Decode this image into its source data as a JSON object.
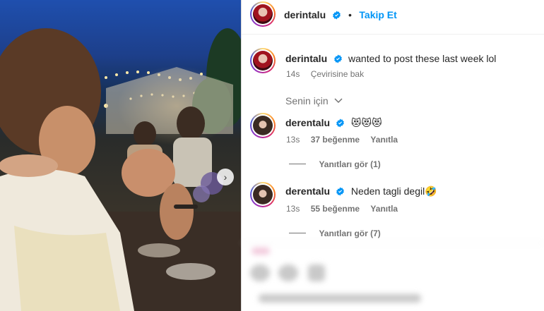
{
  "post": {
    "username": "derintalu",
    "follow_label": "Takip Et",
    "dot": "•"
  },
  "caption": {
    "username": "derintalu",
    "text": "wanted to post these last week lol",
    "time": "14s",
    "translate": "Çevirisine bak"
  },
  "sort": {
    "label": "Senin için"
  },
  "comments": [
    {
      "username": "derentalu",
      "text": "😻😻😻",
      "time": "13s",
      "likes": "37 beğenme",
      "reply": "Yanıtla",
      "view_replies": "Yanıtları gör (1)"
    },
    {
      "username": "derentalu",
      "text": "Neden tagli degil🤣",
      "time": "13s",
      "likes": "55 beğenme",
      "reply": "Yanıtla",
      "view_replies": "Yanıtları gör (7)"
    }
  ],
  "colors": {
    "link_blue": "#0095f6",
    "verified_blue": "#0095f6",
    "muted": "#737373",
    "text": "#262626"
  },
  "icons": [
    "verified-badge-icon",
    "chevron-down-icon",
    "chevron-right-icon"
  ]
}
